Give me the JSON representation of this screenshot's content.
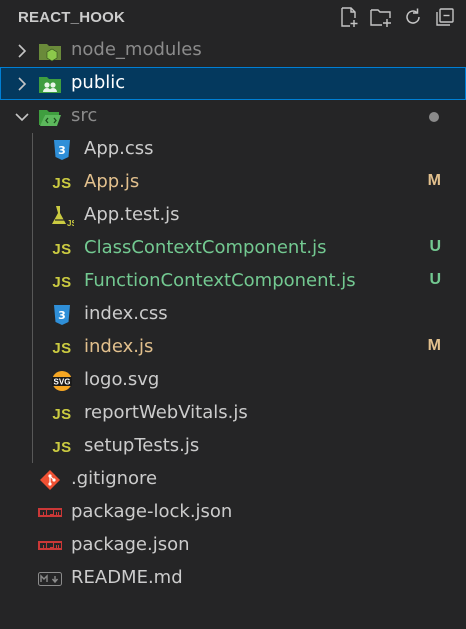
{
  "explorer": {
    "title": "REACT_HOOK",
    "actions": [
      {
        "name": "new-file-icon"
      },
      {
        "name": "new-folder-icon"
      },
      {
        "name": "refresh-icon"
      },
      {
        "name": "collapse-all-icon"
      }
    ]
  },
  "colors": {
    "modified": "#e2c08d",
    "untracked": "#73c991",
    "default": "#cccccc",
    "dim": "#8b8b8b",
    "selection": "#04395e"
  },
  "tree": {
    "node_modules": {
      "label": "node_modules"
    },
    "public": {
      "label": "public"
    },
    "src": {
      "label": "src"
    },
    "src_files": [
      {
        "label": "App.css",
        "icon": "css-icon",
        "badge": ""
      },
      {
        "label": "App.js",
        "icon": "js-icon",
        "badge": "M"
      },
      {
        "label": "App.test.js",
        "icon": "test-js-icon",
        "badge": ""
      },
      {
        "label": "ClassContextComponent.js",
        "icon": "js-icon",
        "badge": "U"
      },
      {
        "label": "FunctionContextComponent.js",
        "icon": "js-icon",
        "badge": "U"
      },
      {
        "label": "index.css",
        "icon": "css-icon",
        "badge": ""
      },
      {
        "label": "index.js",
        "icon": "js-icon",
        "badge": "M"
      },
      {
        "label": "logo.svg",
        "icon": "svg-icon",
        "badge": ""
      },
      {
        "label": "reportWebVitals.js",
        "icon": "js-icon",
        "badge": ""
      },
      {
        "label": "setupTests.js",
        "icon": "js-icon",
        "badge": ""
      }
    ],
    "root_files": [
      {
        "label": ".gitignore",
        "icon": "git-icon"
      },
      {
        "label": "package-lock.json",
        "icon": "npm-icon"
      },
      {
        "label": "package.json",
        "icon": "npm-icon"
      },
      {
        "label": "README.md",
        "icon": "markdown-icon"
      }
    ]
  }
}
